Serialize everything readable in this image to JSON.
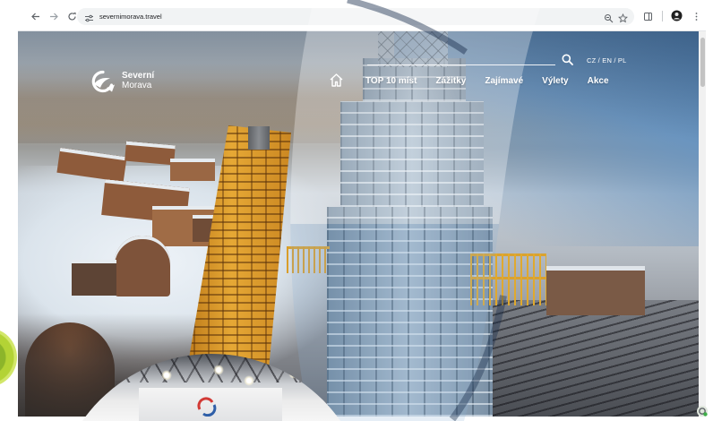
{
  "browser": {
    "url": "severnimorava.travel",
    "icons": {
      "back": "back-arrow-icon",
      "forward": "forward-arrow-icon",
      "reload": "reload-icon",
      "site_info": "site-settings-icon",
      "zoom": "zoom-icon",
      "bookmark": "star-icon",
      "side_panel": "side-panel-icon",
      "profile": "profile-avatar-icon",
      "menu": "kebab-menu-icon"
    }
  },
  "site": {
    "logo": {
      "line1": "Severní",
      "line2": "Morava"
    },
    "languages": "CZ / EN / PL",
    "nav": [
      {
        "label": "TOP 10 míst"
      },
      {
        "label": "Zážitky"
      },
      {
        "label": "Zajímavé"
      },
      {
        "label": "Výlety"
      },
      {
        "label": "Akce"
      }
    ],
    "icons": {
      "home": "home-icon",
      "search": "search-icon",
      "logo": "logo-icon"
    }
  },
  "colors": {
    "nav_text": "#ffffff",
    "accent_green": "#b3d335",
    "tower_yellow": "#e6a835",
    "sky_blue": "#4877a8"
  }
}
